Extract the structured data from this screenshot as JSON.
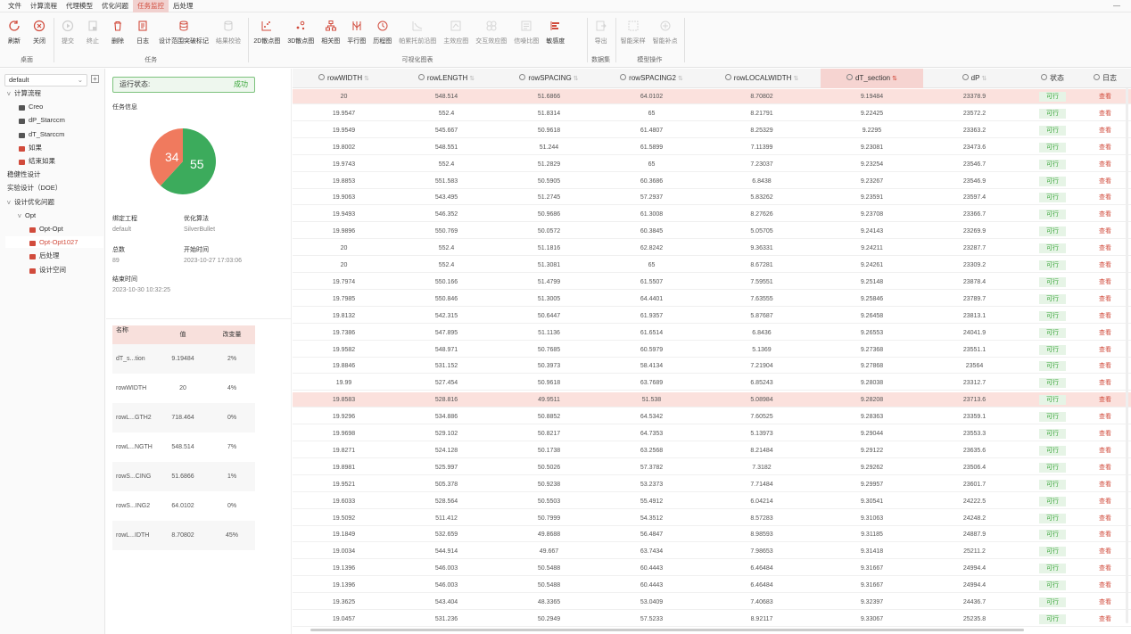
{
  "menu": [
    "文件",
    "计算流程",
    "代理模型",
    "优化问题",
    "任务监控",
    "后处理"
  ],
  "menu_active": 4,
  "window_controls": "—",
  "ribbon": {
    "groups": [
      {
        "label": "桌面",
        "buttons": [
          {
            "label": "刷新",
            "icon": "refresh-icon"
          },
          {
            "label": "关闭",
            "icon": "close-circle-icon"
          }
        ]
      },
      {
        "label": "任务",
        "buttons": [
          {
            "label": "提交",
            "icon": "play-icon",
            "disabled": true
          },
          {
            "label": "终止",
            "icon": "stop-doc-icon",
            "disabled": true
          },
          {
            "label": "删除",
            "icon": "trash-icon"
          },
          {
            "label": "日志",
            "icon": "log-icon"
          },
          {
            "label": "设计范围突破标记",
            "icon": "database-icon"
          },
          {
            "label": "结果校验",
            "icon": "check-db-icon",
            "disabled": true
          }
        ]
      },
      {
        "label": "可视化图表",
        "buttons": [
          {
            "label": "2D散点图",
            "icon": "scatter-2d-icon"
          },
          {
            "label": "3D散点图",
            "icon": "scatter-3d-icon"
          },
          {
            "label": "相关图",
            "icon": "correlation-icon"
          },
          {
            "label": "平行图",
            "icon": "parallel-icon"
          },
          {
            "label": "历程图",
            "icon": "history-icon"
          },
          {
            "label": "帕累托前沿图",
            "icon": "pareto-icon",
            "disabled": true
          },
          {
            "label": "主效应图",
            "icon": "main-effect-icon",
            "disabled": true
          },
          {
            "label": "交互效应图",
            "icon": "interaction-icon",
            "disabled": true
          },
          {
            "label": "信噪比图",
            "icon": "snr-icon",
            "disabled": true
          },
          {
            "label": "敏感度",
            "icon": "sensitivity-icon"
          }
        ]
      },
      {
        "label": "数据集",
        "buttons": [
          {
            "label": "导出",
            "icon": "export-icon",
            "disabled": true
          }
        ]
      },
      {
        "label": "模型操作",
        "buttons": [
          {
            "label": "智能采样",
            "icon": "sampling-icon",
            "disabled": true
          },
          {
            "label": "智能补点",
            "icon": "add-point-icon",
            "disabled": true
          }
        ]
      }
    ]
  },
  "tree": {
    "project": "default",
    "nodes": [
      {
        "label": "计算流程",
        "level": 0,
        "arrow": "v"
      },
      {
        "label": "Creo",
        "level": 1,
        "icon": "creo-icon"
      },
      {
        "label": "dP_Starccm",
        "level": 1,
        "icon": "starccm-icon"
      },
      {
        "label": "dT_Starccm",
        "level": 1,
        "icon": "starccm-icon"
      },
      {
        "label": "如果",
        "level": 1,
        "icon": "branch-icon"
      },
      {
        "label": "结束如果",
        "level": 1,
        "icon": "branch-icon"
      },
      {
        "label": "稳健性设计",
        "level": 0
      },
      {
        "label": "实验设计（DOE）",
        "level": 0
      },
      {
        "label": "设计优化问题",
        "level": 0,
        "arrow": "v"
      },
      {
        "label": "Opt",
        "level": 1,
        "arrow": "v"
      },
      {
        "label": "Opt-Opt",
        "level": 2,
        "icon": "opt-icon"
      },
      {
        "label": "Opt-Opt1027",
        "level": 2,
        "icon": "opt-icon",
        "selected": true
      },
      {
        "label": "后处理",
        "level": 2,
        "icon": "post-icon"
      },
      {
        "label": "设计空间",
        "level": 2,
        "icon": "space-icon"
      }
    ]
  },
  "info": {
    "run_state_label": "运行状态:",
    "run_state_value": "成功",
    "task_info_title": "任务信息",
    "pie": {
      "a": 34,
      "b": 55,
      "color_a": "#f07a5e",
      "color_b": "#3cab5c"
    },
    "fields": [
      {
        "label": "绑定工程",
        "value": "default"
      },
      {
        "label": "优化算法",
        "value": "SilverBullet"
      },
      {
        "label": "总数",
        "value": "89"
      },
      {
        "label": "开始时间",
        "value": "2023-10-27 17:03:06"
      },
      {
        "label": "结束时间",
        "value": "2023-10-30 10:32:25"
      }
    ],
    "param_headers": [
      "名称",
      "值",
      "改变量"
    ],
    "params": [
      {
        "name": "dT_s...tion",
        "value": "9.19484",
        "change": "2%"
      },
      {
        "name": "rowWIDTH",
        "value": "20",
        "change": "4%"
      },
      {
        "name": "rowL...GTH2",
        "value": "718.464",
        "change": "0%"
      },
      {
        "name": "rowL...NGTH",
        "value": "548.514",
        "change": "7%"
      },
      {
        "name": "rowS...CING",
        "value": "51.6866",
        "change": "1%"
      },
      {
        "name": "rowS...ING2",
        "value": "64.0102",
        "change": "0%"
      },
      {
        "name": "rowL...IDTH",
        "value": "8.70802",
        "change": "45%"
      }
    ]
  },
  "grid": {
    "columns": [
      "rowWIDTH",
      "rowLENGTH",
      "rowSPACING",
      "rowSPACING2",
      "rowLOCALWIDTH",
      "dT_section",
      "dP",
      "状态",
      "日志"
    ],
    "sorted_column": 5,
    "status_text": "可行",
    "log_text": "查看",
    "rows": [
      [
        "20",
        "548.514",
        "51.6866",
        "64.0102",
        "8.70802",
        "9.19484",
        "23378.9"
      ],
      [
        "19.9547",
        "552.4",
        "51.8314",
        "65",
        "8.21791",
        "9.22425",
        "23572.2"
      ],
      [
        "19.9549",
        "545.667",
        "50.9618",
        "61.4807",
        "8.25329",
        "9.2295",
        "23363.2"
      ],
      [
        "19.8002",
        "548.551",
        "51.244",
        "61.5899",
        "7.11399",
        "9.23081",
        "23473.6"
      ],
      [
        "19.9743",
        "552.4",
        "51.2829",
        "65",
        "7.23037",
        "9.23254",
        "23546.7"
      ],
      [
        "19.8853",
        "551.583",
        "50.5905",
        "60.3686",
        "6.8438",
        "9.23267",
        "23546.9"
      ],
      [
        "19.9063",
        "543.495",
        "51.2745",
        "57.2937",
        "5.83262",
        "9.23591",
        "23597.4"
      ],
      [
        "19.9493",
        "546.352",
        "50.9686",
        "61.3008",
        "8.27626",
        "9.23708",
        "23366.7"
      ],
      [
        "19.9896",
        "550.769",
        "50.0572",
        "60.3845",
        "5.05705",
        "9.24143",
        "23269.9"
      ],
      [
        "20",
        "552.4",
        "51.1816",
        "62.8242",
        "9.36331",
        "9.24211",
        "23287.7"
      ],
      [
        "20",
        "552.4",
        "51.3081",
        "65",
        "8.67281",
        "9.24261",
        "23309.2"
      ],
      [
        "19.7974",
        "550.166",
        "51.4799",
        "61.5507",
        "7.59551",
        "9.25148",
        "23878.4"
      ],
      [
        "19.7985",
        "550.846",
        "51.3005",
        "64.4401",
        "7.63555",
        "9.25846",
        "23789.7"
      ],
      [
        "19.8132",
        "542.315",
        "50.6447",
        "61.9357",
        "5.87687",
        "9.26458",
        "23813.1"
      ],
      [
        "19.7386",
        "547.895",
        "51.1136",
        "61.6514",
        "6.8436",
        "9.26553",
        "24041.9"
      ],
      [
        "19.9582",
        "548.971",
        "50.7685",
        "60.5979",
        "5.1369",
        "9.27368",
        "23551.1"
      ],
      [
        "19.8846",
        "531.152",
        "50.3973",
        "58.4134",
        "7.21904",
        "9.27868",
        "23564"
      ],
      [
        "19.99",
        "527.454",
        "50.9618",
        "63.7689",
        "6.85243",
        "9.28038",
        "23312.7"
      ],
      [
        "19.8583",
        "528.816",
        "49.9511",
        "51.538",
        "5.08984",
        "9.28208",
        "23713.6"
      ],
      [
        "19.9296",
        "534.886",
        "50.8852",
        "64.5342",
        "7.60525",
        "9.28363",
        "23359.1"
      ],
      [
        "19.9698",
        "529.102",
        "50.8217",
        "64.7353",
        "5.13973",
        "9.29044",
        "23553.3"
      ],
      [
        "19.8271",
        "524.128",
        "50.1738",
        "63.2568",
        "8.21484",
        "9.29122",
        "23635.6"
      ],
      [
        "19.8981",
        "525.997",
        "50.5026",
        "57.3782",
        "7.3182",
        "9.29262",
        "23506.4"
      ],
      [
        "19.9521",
        "505.378",
        "50.9238",
        "53.2373",
        "7.71484",
        "9.29957",
        "23601.7"
      ],
      [
        "19.6033",
        "528.564",
        "50.5503",
        "55.4912",
        "6.04214",
        "9.30541",
        "24222.5"
      ],
      [
        "19.5092",
        "511.412",
        "50.7999",
        "54.3512",
        "8.57283",
        "9.31063",
        "24248.2"
      ],
      [
        "19.1849",
        "532.659",
        "49.8688",
        "56.4847",
        "8.98593",
        "9.31185",
        "24887.9"
      ],
      [
        "19.0034",
        "544.914",
        "49.667",
        "63.7434",
        "7.98653",
        "9.31418",
        "25211.2"
      ],
      [
        "19.1396",
        "546.003",
        "50.5488",
        "60.4443",
        "6.46484",
        "9.31667",
        "24994.4"
      ],
      [
        "19.1396",
        "546.003",
        "50.5488",
        "60.4443",
        "6.46484",
        "9.31667",
        "24994.4"
      ],
      [
        "19.3625",
        "543.404",
        "48.3365",
        "53.0409",
        "7.40683",
        "9.32397",
        "24436.7"
      ],
      [
        "19.0457",
        "531.236",
        "50.2949",
        "57.5233",
        "8.92117",
        "9.33067",
        "25235.8"
      ]
    ],
    "highlight_rows": [
      0,
      18
    ]
  }
}
